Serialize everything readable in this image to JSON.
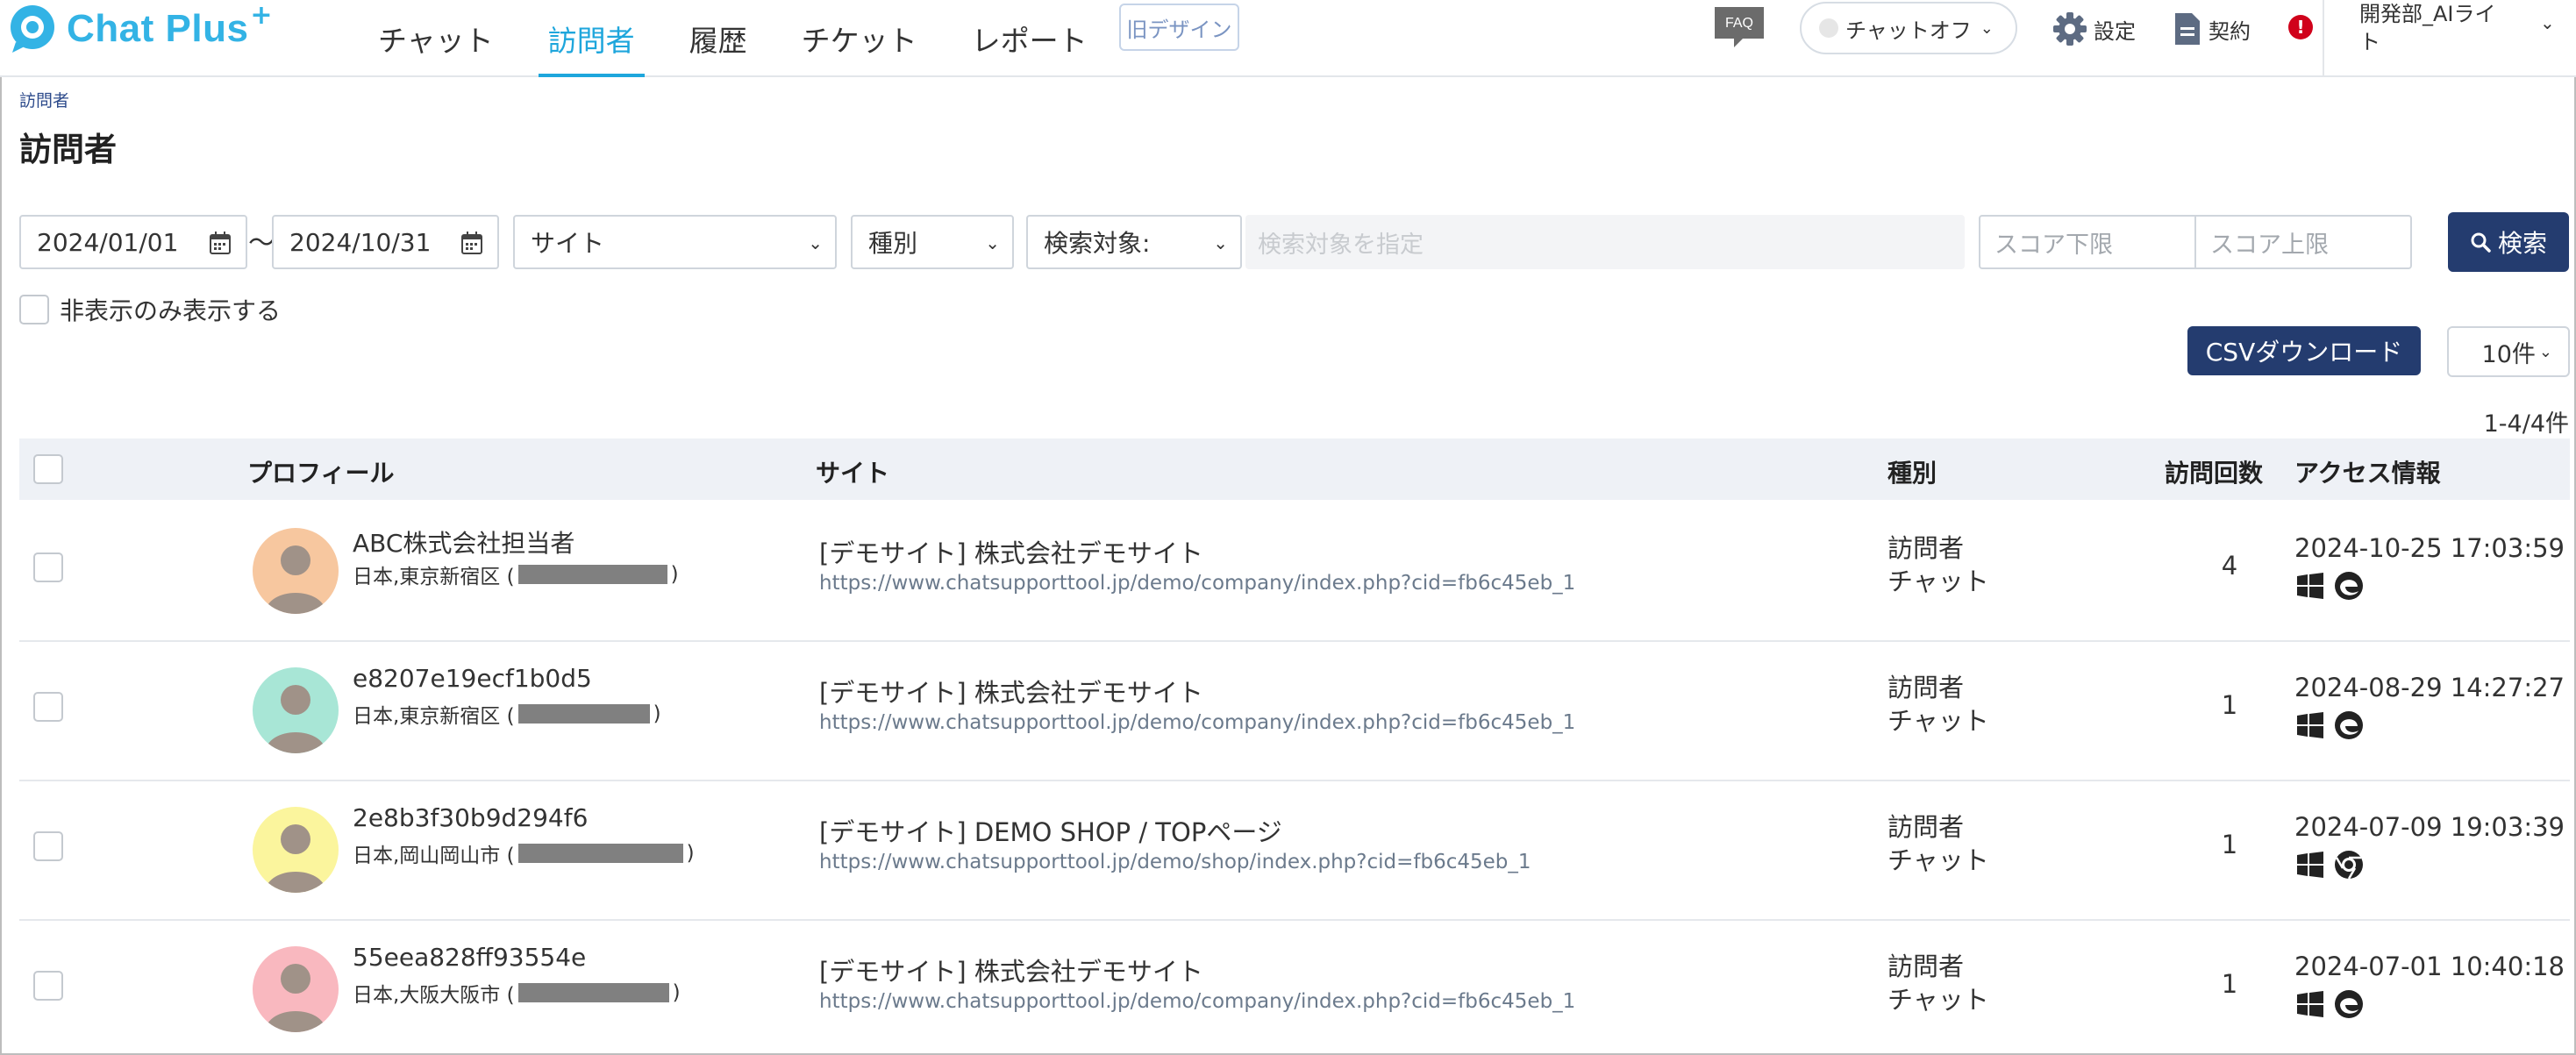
{
  "header": {
    "logo_text": "Chat Plus",
    "logo_plus": "+",
    "nav": [
      {
        "label": "チャット",
        "active": false
      },
      {
        "label": "訪問者",
        "active": true
      },
      {
        "label": "履歴",
        "active": false
      },
      {
        "label": "チケット",
        "active": false
      },
      {
        "label": "レポート",
        "active": false
      }
    ],
    "old_design": "旧デザイン",
    "faq": "FAQ",
    "chat_status": "チャットオフ",
    "settings": "設定",
    "contract": "契約",
    "alert": "!",
    "user_line1": "開発部_AIライ",
    "user_line2": "ト"
  },
  "breadcrumb": "訪問者",
  "page_title": "訪問者",
  "filters": {
    "date_from": "2024/01/01",
    "tilde": "～",
    "date_to": "2024/10/31",
    "site_select": "サイト",
    "kind_select": "種別",
    "target_select": "検索対象:",
    "target_placeholder": "検索対象を指定",
    "score_min_placeholder": "スコア下限",
    "score_max_placeholder": "スコア上限",
    "search_button": "検索",
    "hidden_only_label": "非表示のみ表示する"
  },
  "actions": {
    "csv_button": "CSVダウンロード",
    "per_page": "10件",
    "result_count": "1-4/4件"
  },
  "table": {
    "headers": {
      "profile": "プロフィール",
      "site": "サイト",
      "kind": "種別",
      "visits": "訪問回数",
      "access": "アクセス情報"
    },
    "rows": [
      {
        "name": "ABC株式会社担当者",
        "location": "日本,東京新宿区 (",
        "location_end": ")",
        "avatar_color": "#f7c79f",
        "site_name": "[デモサイト] 株式会社デモサイト",
        "site_url": "https://www.chatsupporttool.jp/demo/company/index.php?cid=fb6c45eb_1",
        "kind1": "訪問者",
        "kind2": "チャット",
        "visits": "4",
        "access_time": "2024-10-25 17:03:59",
        "browser": "edge"
      },
      {
        "name": "e8207e19ecf1b0d5",
        "location": "日本,東京新宿区 (",
        "location_end": ")",
        "avatar_color": "#a8e6d6",
        "site_name": "[デモサイト] 株式会社デモサイト",
        "site_url": "https://www.chatsupporttool.jp/demo/company/index.php?cid=fb6c45eb_1",
        "kind1": "訪問者",
        "kind2": "チャット",
        "visits": "1",
        "access_time": "2024-08-29 14:27:27",
        "browser": "edge"
      },
      {
        "name": "2e8b3f30b9d294f6",
        "location": "日本,岡山岡山市 (",
        "location_end": ")",
        "avatar_color": "#fbf59d",
        "site_name": "[デモサイト] DEMO SHOP / TOPページ",
        "site_url": "https://www.chatsupporttool.jp/demo/shop/index.php?cid=fb6c45eb_1",
        "kind1": "訪問者",
        "kind2": "チャット",
        "visits": "1",
        "access_time": "2024-07-09 19:03:39",
        "browser": "chrome"
      },
      {
        "name": "55eea828ff93554e",
        "location": "日本,大阪大阪市 (",
        "location_end": ")",
        "avatar_color": "#f9b8bf",
        "site_name": "[デモサイト] 株式会社デモサイト",
        "site_url": "https://www.chatsupporttool.jp/demo/company/index.php?cid=fb6c45eb_1",
        "kind1": "訪問者",
        "kind2": "チャット",
        "visits": "1",
        "access_time": "2024-07-01 10:40:18",
        "browser": "edge"
      }
    ]
  },
  "colors": {
    "accent": "#1ea6dc",
    "primary_button": "#243c6f",
    "logo": "#33b3e5"
  }
}
